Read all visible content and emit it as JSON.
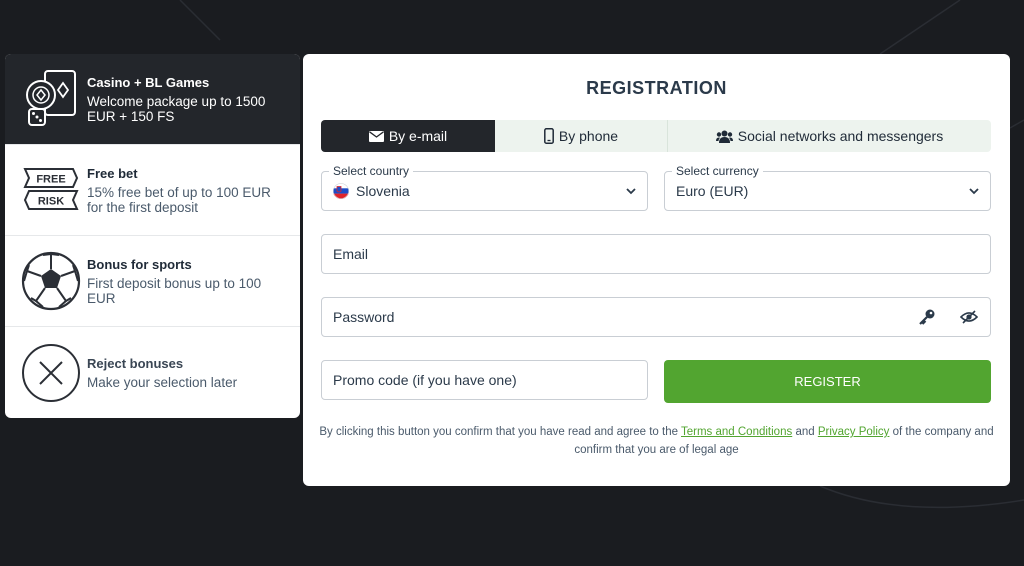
{
  "bonuses": [
    {
      "title": "Casino + BL Games",
      "desc": "Welcome package up to 1500 EUR + 150 FS",
      "icon": "casino-chips-icon",
      "active": true
    },
    {
      "title": "Free bet",
      "desc": "15% free bet of up to 100 EUR for the first deposit",
      "icon": "free-risk-icon",
      "badge_top": "FREE",
      "badge_bottom": "RISK"
    },
    {
      "title": "Bonus for sports",
      "desc": "First deposit bonus up to 100 EUR",
      "icon": "soccer-ball-icon"
    },
    {
      "title": "Reject bonuses",
      "desc": "Make your selection later",
      "icon": "close-circle-icon"
    }
  ],
  "registration": {
    "title": "REGISTRATION",
    "tabs": [
      {
        "label": "By e-mail",
        "icon": "envelope-icon",
        "active": true
      },
      {
        "label": "By phone",
        "icon": "phone-icon"
      },
      {
        "label": "Social networks and messengers",
        "icon": "users-icon"
      }
    ],
    "country": {
      "label": "Select country",
      "value": "Slovenia"
    },
    "currency": {
      "label": "Select currency",
      "value": "Euro (EUR)"
    },
    "email_placeholder": "Email",
    "password_placeholder": "Password",
    "promo_placeholder": "Promo code (if you have one)",
    "register_label": "REGISTER",
    "legal": {
      "part1": "By clicking this button you confirm that you have read and agree to the",
      "terms": "Terms and Conditions",
      "and": "and",
      "privacy": "Privacy Policy",
      "part2": "of the company and confirm that you are of legal age"
    }
  },
  "colors": {
    "accent": "#52a530",
    "dark": "#23262b",
    "background": "#1a1c20"
  }
}
